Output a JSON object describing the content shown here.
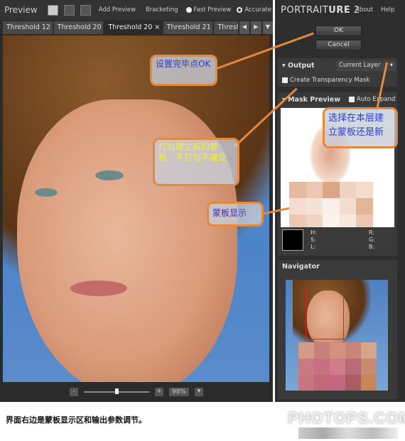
{
  "toolbar": {
    "title": "Preview",
    "add_preview": "Add Preview",
    "bracketing": "Bracketing",
    "fast_preview": "Fast Preview",
    "accurate": "Accurate",
    "mode": "Fast Preview"
  },
  "tabs": [
    {
      "label": "Threshold 12"
    },
    {
      "label": "Threshold 20"
    },
    {
      "label": "Threshold 20 ×",
      "active": true
    },
    {
      "label": "Threshold 21"
    },
    {
      "label": "Thresh"
    }
  ],
  "zoom": {
    "minus": "-",
    "plus": "+",
    "value": "98%"
  },
  "right": {
    "brand_a": "PORTRAIT",
    "brand_b": "URE",
    "brand_c": " 2",
    "about": "About",
    "help": "Help",
    "ok": "OK",
    "cancel": "Cancel",
    "output_label": "Output",
    "output_value": "Current Layer",
    "transparency": "Create Transparency Mask",
    "transparency_checked": true,
    "mask_preview": "Mask Preview",
    "auto_expand": "Auto Expand",
    "auto_expand_checked": true,
    "h": "H:",
    "s": "S:",
    "l": "L:",
    "r": "R:",
    "g": "G:",
    "b": "B:",
    "navigator": "Navigator"
  },
  "callouts": {
    "ok_note": "设置完毕点OK",
    "mask_note": "打勾建立新的蒙板、不打勾不建立",
    "display_note": "蒙板显示",
    "layer_note": "选择在本层建立蒙板还是新"
  },
  "caption": "界面右边是蒙板显示区和输出参数调节。",
  "watermark": "PHOTOPS.COM",
  "colors": {
    "accent": "#e38a3e",
    "callout_blue": "#2a3fd0",
    "callout_yellow": "#f4f03a"
  }
}
